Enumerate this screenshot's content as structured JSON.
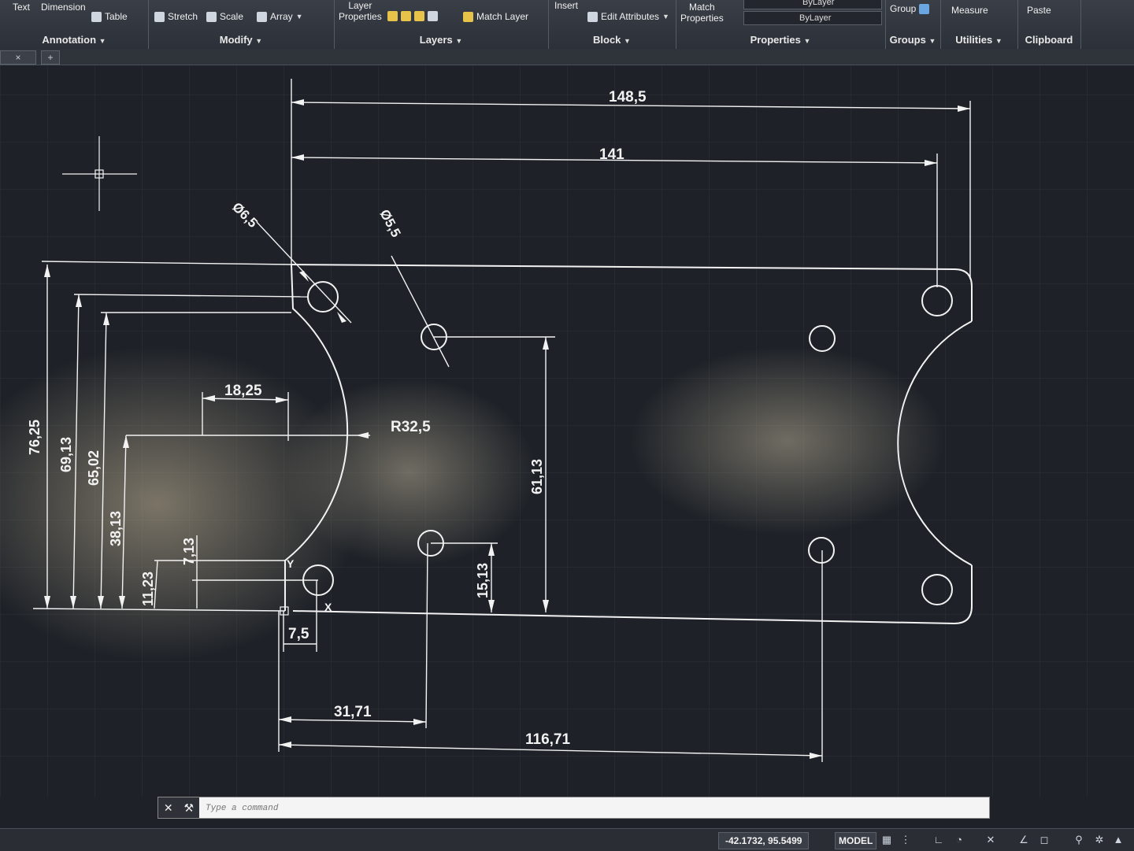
{
  "ribbon": {
    "annotation": {
      "text": "Text",
      "dimension": "Dimension",
      "table": "Table",
      "panel": "Annotation"
    },
    "modify": {
      "stretch": "Stretch",
      "scale": "Scale",
      "array": "Array",
      "panel": "Modify"
    },
    "layers": {
      "layer_properties_1": "Layer",
      "layer_properties_2": "Properties",
      "match_layer": "Match Layer",
      "panel": "Layers"
    },
    "block": {
      "insert": "Insert",
      "edit_attributes": "Edit Attributes",
      "panel": "Block"
    },
    "properties": {
      "match_1": "Match",
      "match_2": "Properties",
      "bylayer_top": "ByLayer",
      "bylayer": "ByLayer",
      "panel": "Properties"
    },
    "groups": {
      "group": "Group",
      "panel": "Groups"
    },
    "utilities": {
      "measure": "Measure",
      "panel": "Utilities"
    },
    "clipboard": {
      "paste": "Paste",
      "panel": "Clipboard"
    }
  },
  "tabs": {
    "close": "×",
    "add": "+"
  },
  "drawing": {
    "dimensions": {
      "overall_width": "148,5",
      "hole_span": "141",
      "hole_dia_large": "Ø6,5",
      "hole_dia_small": "Ø5,5",
      "height_total": "76,25",
      "height_1": "69,13",
      "height_2": "65,02",
      "height_3": "38,13",
      "height_4": "11,23",
      "height_5": "7,13",
      "arc_depth": "18,25",
      "arc_radius": "R32,5",
      "hole_height": "61,13",
      "small_height": "15,13",
      "offset_1": "7,5",
      "offset_2": "31,71",
      "offset_3": "116,71"
    },
    "ucs": {
      "y": "Y",
      "x": "X"
    }
  },
  "command_line": {
    "placeholder": "Type a command",
    "prompt": "▸·"
  },
  "status_bar": {
    "coords": "-42.1732, 95.5499",
    "space": "MODEL"
  },
  "colors": {
    "canvas": "#1e2228",
    "geometry": "#f2f2f2",
    "ribbon": "#2c3038"
  }
}
